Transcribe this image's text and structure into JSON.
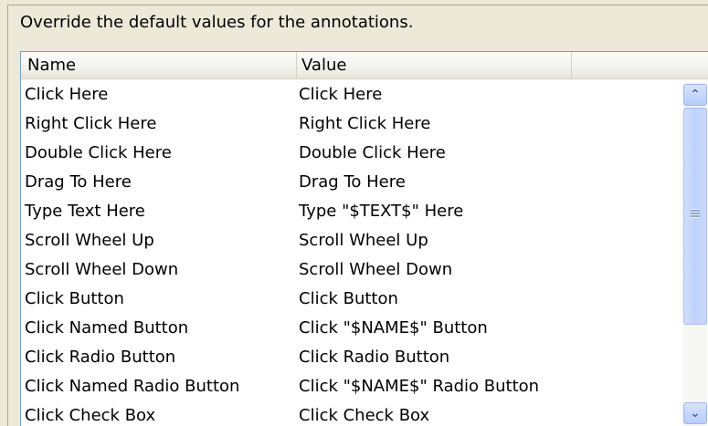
{
  "description": "Override the default values for the annotations.",
  "list": {
    "columns": [
      "Name",
      "Value"
    ],
    "rows": [
      {
        "name": "Click Here",
        "value": "Click Here"
      },
      {
        "name": "Right Click Here",
        "value": "Right Click Here"
      },
      {
        "name": "Double Click Here",
        "value": "Double Click Here"
      },
      {
        "name": "Drag To Here",
        "value": "Drag To Here"
      },
      {
        "name": "Type Text Here",
        "value": "Type \"$TEXT$\" Here"
      },
      {
        "name": "Scroll Wheel Up",
        "value": "Scroll Wheel Up"
      },
      {
        "name": "Scroll Wheel Down",
        "value": "Scroll Wheel Down"
      },
      {
        "name": "Click Button",
        "value": "Click Button"
      },
      {
        "name": "Click Named Button",
        "value": "Click \"$NAME$\" Button"
      },
      {
        "name": "Click Radio Button",
        "value": "Click Radio Button"
      },
      {
        "name": "Click Named Radio Button",
        "value": "Click \"$NAME$\" Radio Button"
      },
      {
        "name": "Click Check Box",
        "value": "Click Check Box"
      }
    ]
  },
  "scrollbar": {
    "up_icon": "scroll-up-arrow-icon",
    "down_icon": "scroll-down-arrow-icon",
    "up_glyph": "⌃",
    "down_glyph": "⌄"
  }
}
